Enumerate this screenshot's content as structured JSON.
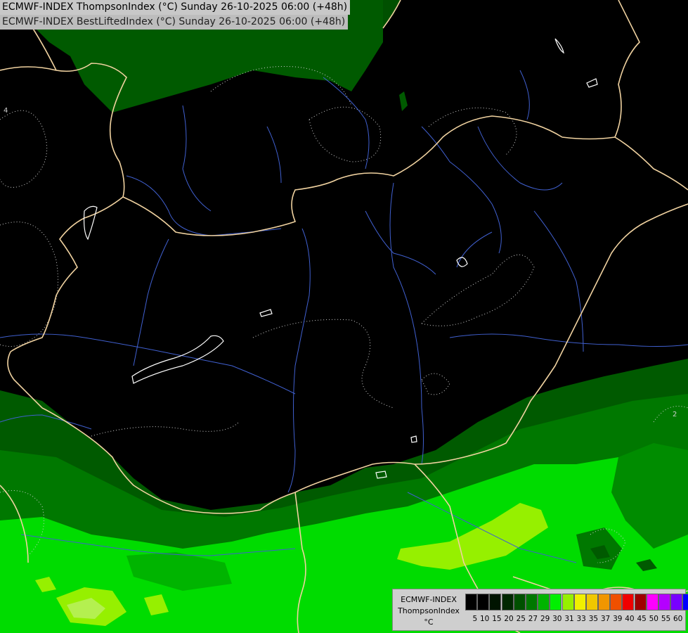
{
  "header": {
    "line1": "ECMWF-INDEX ThompsonIndex (°C) Sunday 26-10-2025 06:00 (+48h)",
    "line2": "ECMWF-INDEX BestLiftedIndex (°C) Sunday 26-10-2025 06:00 (+48h)"
  },
  "contour_labels": [
    "4",
    "2"
  ],
  "legend": {
    "model": "ECMWF-INDEX",
    "parameter": "ThompsonIndex",
    "unit": "°C",
    "ticks": [
      "5",
      "10",
      "15",
      "20",
      "25",
      "27",
      "29",
      "30",
      "31",
      "33",
      "35",
      "37",
      "39",
      "40",
      "45",
      "50",
      "55",
      "60"
    ],
    "colors": [
      "#000000",
      "#000000",
      "#001400",
      "#002800",
      "#005000",
      "#007800",
      "#00b400",
      "#00f000",
      "#96f000",
      "#f0f000",
      "#f0c800",
      "#f09600",
      "#f05000",
      "#f00000",
      "#a00000",
      "#ff00ff",
      "#b400ff",
      "#7800ff",
      "#0000ff"
    ]
  },
  "colors": {
    "background": "#000000",
    "dark_green": "#005a00",
    "mid_green": "#007800",
    "bright_green": "#00dc00",
    "lime": "#96f000",
    "border": "#f0d2a0",
    "rivers": "#4060d0",
    "lakes": "#ffffff"
  }
}
